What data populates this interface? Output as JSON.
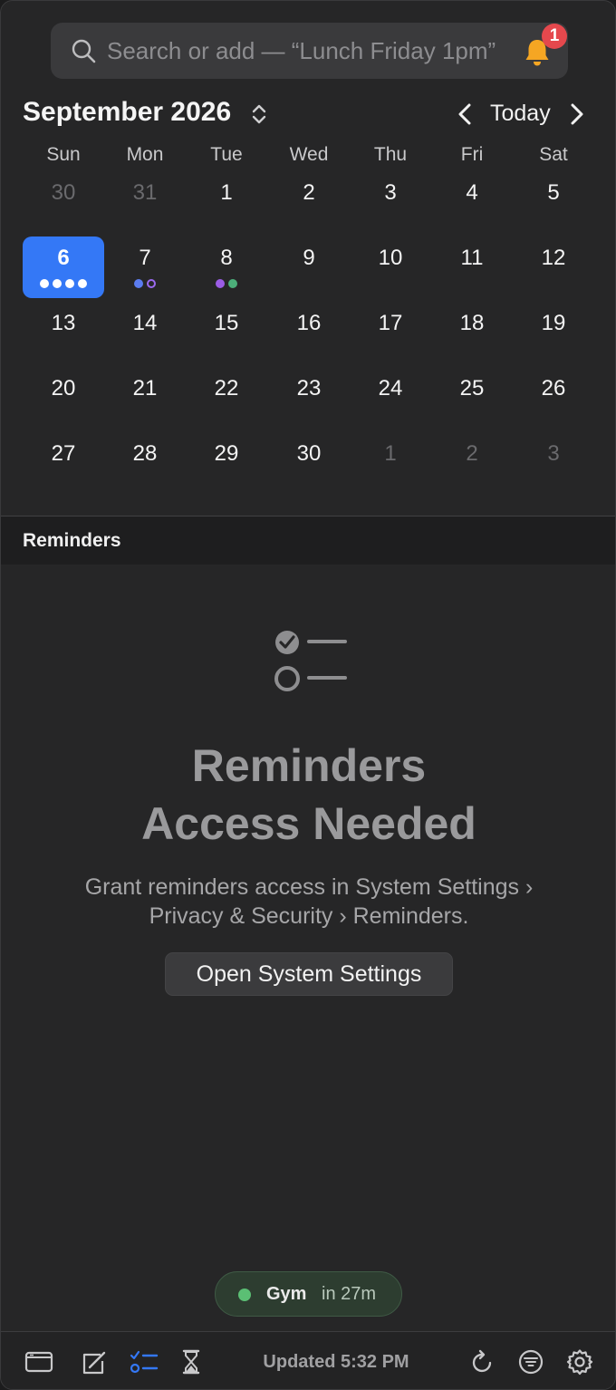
{
  "search": {
    "placeholder": "Search or add — “Lunch Friday 1pm”",
    "icon": "search-icon",
    "notifications": {
      "icon": "bell-icon",
      "badge_count": "1",
      "color": "#f5a623"
    }
  },
  "header": {
    "month_title": "September 2026",
    "today_label": "Today"
  },
  "calendar": {
    "weekdays": [
      "Sun",
      "Mon",
      "Tue",
      "Wed",
      "Thu",
      "Fri",
      "Sat"
    ],
    "weeks": [
      [
        {
          "day": "30",
          "current": false
        },
        {
          "day": "31",
          "current": false
        },
        {
          "day": "1",
          "current": true
        },
        {
          "day": "2",
          "current": true
        },
        {
          "day": "3",
          "current": true
        },
        {
          "day": "4",
          "current": true
        },
        {
          "day": "5",
          "current": true
        }
      ],
      [
        {
          "day": "6",
          "current": true,
          "selected": true,
          "dots": [
            "#ffffff",
            "#ffffff",
            "#ffffff",
            "#ffffff"
          ]
        },
        {
          "day": "7",
          "current": true,
          "dots": [
            "#5b7cf0",
            "ring:#9b6af0"
          ]
        },
        {
          "day": "8",
          "current": true,
          "dots": [
            "#9b5de5",
            "#4caf7a"
          ]
        },
        {
          "day": "9",
          "current": true
        },
        {
          "day": "10",
          "current": true
        },
        {
          "day": "11",
          "current": true
        },
        {
          "day": "12",
          "current": true
        }
      ],
      [
        {
          "day": "13",
          "current": true
        },
        {
          "day": "14",
          "current": true
        },
        {
          "day": "15",
          "current": true
        },
        {
          "day": "16",
          "current": true
        },
        {
          "day": "17",
          "current": true
        },
        {
          "day": "18",
          "current": true
        },
        {
          "day": "19",
          "current": true
        }
      ],
      [
        {
          "day": "20",
          "current": true
        },
        {
          "day": "21",
          "current": true
        },
        {
          "day": "22",
          "current": true
        },
        {
          "day": "23",
          "current": true
        },
        {
          "day": "24",
          "current": true
        },
        {
          "day": "25",
          "current": true
        },
        {
          "day": "26",
          "current": true
        }
      ],
      [
        {
          "day": "27",
          "current": true
        },
        {
          "day": "28",
          "current": true
        },
        {
          "day": "29",
          "current": true
        },
        {
          "day": "30",
          "current": true
        },
        {
          "day": "1",
          "current": false
        },
        {
          "day": "2",
          "current": false
        },
        {
          "day": "3",
          "current": false
        }
      ]
    ],
    "selected_color": "#3478f6"
  },
  "reminders": {
    "section_title": "Reminders",
    "empty_title_line1": "Reminders",
    "empty_title_line2": "Access Needed",
    "empty_desc_line1": "Grant reminders access in System Settings ›",
    "empty_desc_line2": "Privacy & Security › Reminders.",
    "button_label": "Open System Settings",
    "icon": "checklist-icon"
  },
  "upcoming": {
    "title": "Gym",
    "time": "in 27m",
    "color": "#5bbf74"
  },
  "toolbar": {
    "updated_label": "Updated 5:32 PM",
    "left_icons": [
      "calendar-view-icon",
      "compose-icon",
      "reminders-list-icon",
      "hourglass-icon"
    ],
    "right_icons": [
      "refresh-icon",
      "filter-icon",
      "settings-gear-icon"
    ],
    "active_color": "#3478f6"
  }
}
